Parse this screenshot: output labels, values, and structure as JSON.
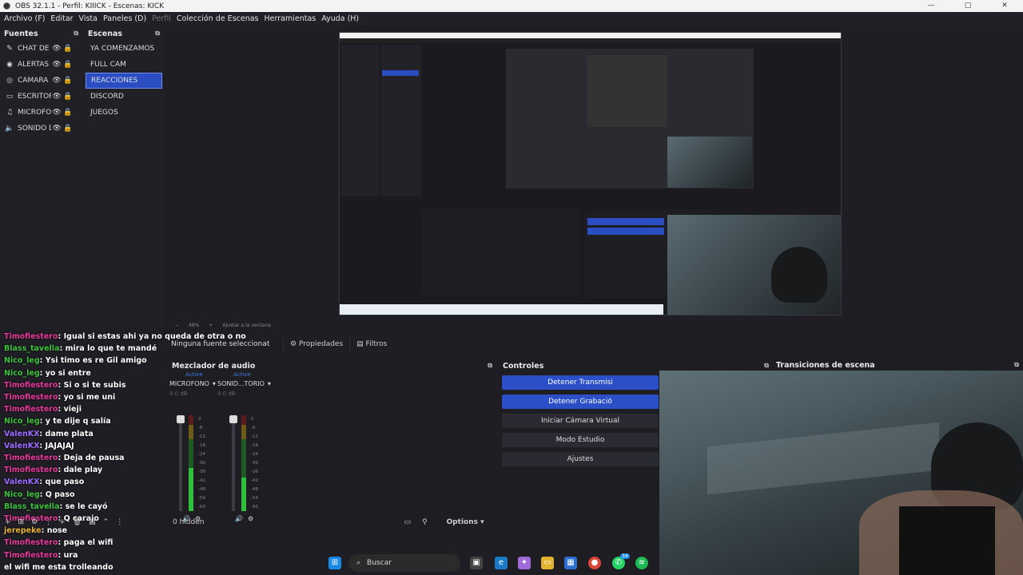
{
  "window": {
    "title": "OBS 32.1.1 - Perfil: KIIICK - Escenas: KICK",
    "min": "—",
    "max": "▢",
    "close": "✕"
  },
  "menu": [
    "Archivo (F)",
    "Editar",
    "Vista",
    "Paneles (D)",
    "Perfil",
    "Colección de Escenas",
    "Herramientas",
    "Ayuda (H)"
  ],
  "fuentes": {
    "title": "Fuentes",
    "items": [
      {
        "label": "CHAT DE K",
        "icon": "chat-icon"
      },
      {
        "label": "ALERTAS D",
        "icon": "alert-icon"
      },
      {
        "label": "CAMARA",
        "icon": "camera-icon"
      },
      {
        "label": "ESCRITOR",
        "icon": "monitor-icon"
      },
      {
        "label": "MICROFO",
        "icon": "microphone-icon"
      },
      {
        "label": "SONIDO D",
        "icon": "speaker-icon"
      }
    ]
  },
  "escenas": {
    "title": "Escenas",
    "items": [
      "YA COMENZAMOS",
      "FULL CAM",
      "REACCIONES",
      "DISCORD",
      "JUEGOS"
    ],
    "selected_index": 2
  },
  "zoom": {
    "level": "48%",
    "fit": "Ajustar a la ventana"
  },
  "properties_bar": {
    "no_source": "Ninguna fuente seleccionat",
    "properties": "Propiedades",
    "filters": "Filtros"
  },
  "chat": [
    {
      "user": "Timofiestero",
      "msg": "Igual si estas ahi ya no queda de otra o no",
      "color": "#e6399b"
    },
    {
      "user": "Blass_tavella",
      "msg": "mira lo que te mandé",
      "color": "#3ec23e"
    },
    {
      "user": "Nico_leg",
      "msg": "Ysi timo es re Gil amigo",
      "color": "#3ec23e"
    },
    {
      "user": "Nico_leg",
      "msg": "yo si entre",
      "color": "#3ec23e"
    },
    {
      "user": "Timofiestero",
      "msg": "Si o si te subis",
      "color": "#e6399b"
    },
    {
      "user": "Timofiestero",
      "msg": "yo si me uni",
      "color": "#e6399b"
    },
    {
      "user": "Timofiestero",
      "msg": "vieji",
      "color": "#e6399b"
    },
    {
      "user": "Nico_leg",
      "msg": "y te dije q salía",
      "color": "#3ec23e"
    },
    {
      "user": "ValenKX",
      "msg": "dame plata",
      "color": "#9b6cff"
    },
    {
      "user": "ValenKX",
      "msg": "JAJAJAJ",
      "color": "#9b6cff"
    },
    {
      "user": "Timofiestero",
      "msg": "Deja de pausa",
      "color": "#e6399b"
    },
    {
      "user": "Timofiestero",
      "msg": "dale play",
      "color": "#e6399b"
    },
    {
      "user": "ValenKX",
      "msg": "que paso",
      "color": "#9b6cff"
    },
    {
      "user": "Nico_leg",
      "msg": "Q paso",
      "color": "#3ec23e"
    },
    {
      "user": "Blass_tavella",
      "msg": "se le cayó",
      "color": "#3ec23e"
    },
    {
      "user": "Timofiestero",
      "msg": "Q carajo",
      "color": "#e6399b"
    },
    {
      "user": "jerepeke",
      "msg": "nose",
      "color": "#e6b23a"
    },
    {
      "user": "Timofiestero",
      "msg": "paga el wifi",
      "color": "#e6399b"
    },
    {
      "user": "Timofiestero",
      "msg": "ura",
      "color": "#e6399b"
    },
    {
      "user": "",
      "msg": "el wifi me esta trolleando",
      "color": "#3ec23e"
    }
  ],
  "mixer": {
    "title": "Mezclador de audio",
    "channels": [
      {
        "active": "Active",
        "name": "MICROFONO",
        "db": "0.0 dB",
        "level": 0.45,
        "fader": 1.0
      },
      {
        "active": "Active",
        "name": "SONID...TORIO",
        "db": "0.0 dB",
        "level": 0.35,
        "fader": 1.0
      }
    ],
    "scale": [
      "0",
      "-6",
      "-12",
      "-18",
      "-24",
      "-30",
      "-36",
      "-42",
      "-48",
      "-54",
      "-60"
    ],
    "hidden": "0 hidden",
    "options": "Options"
  },
  "controles": {
    "title": "Controles",
    "buttons": [
      {
        "label": "Detener Transmisi",
        "primary": true
      },
      {
        "label": "Detener Grabació",
        "primary": true
      },
      {
        "label": "Iniciar Cámara Virtual",
        "primary": false
      },
      {
        "label": "Modo Estudio",
        "primary": false
      },
      {
        "label": "Ajustes",
        "primary": false
      }
    ]
  },
  "transiciones": {
    "title": "Transiciones de escena"
  },
  "taskbar": {
    "search": "Buscar",
    "badge": "34",
    "icons": [
      "windows-start-icon",
      "search-icon",
      "taskview-icon",
      "edge-icon",
      "copilot-icon",
      "files-icon",
      "store-icon",
      "chrome-icon",
      "whatsapp-icon",
      "spotify-icon"
    ]
  }
}
